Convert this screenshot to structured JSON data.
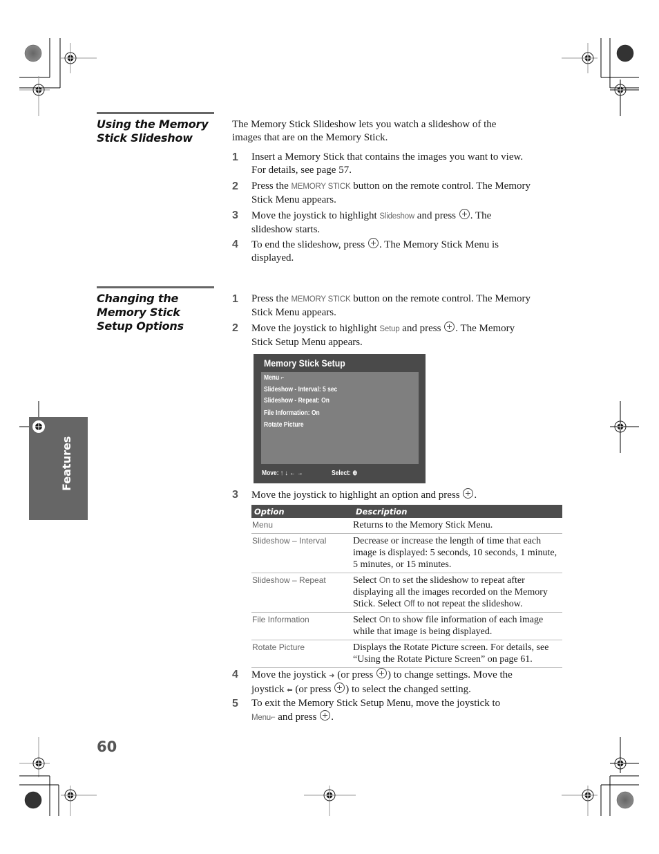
{
  "section1": {
    "title_line1": "Using the Memory",
    "title_line2": "Stick Slideshow",
    "intro_line1": "The Memory Stick Slideshow lets you watch a slideshow of the",
    "intro_line2": "images that are on the Memory Stick.",
    "steps": [
      {
        "num": "1",
        "line1": "Insert a Memory Stick that contains the images you want to view.",
        "line2": "For details, see page 57."
      },
      {
        "num": "2",
        "pre": "Press the ",
        "ui": "MEMORY STICK",
        "post": " button on the remote control. The Memory",
        "line2": "Stick Menu appears."
      },
      {
        "num": "3",
        "pre": "Move the joystick to highlight ",
        "ui": "Slideshow",
        "post": " and press ",
        "post2": ". The",
        "line2": "slideshow starts."
      },
      {
        "num": "4",
        "pre": "To end the slideshow, press ",
        "post": ". The Memory Stick Menu is",
        "line2": "displayed."
      }
    ]
  },
  "section2": {
    "title_line1": "Changing the",
    "title_line2": "Memory Stick",
    "title_line3": "Setup Options",
    "steps": [
      {
        "num": "1",
        "pre": "Press the ",
        "ui": "MEMORY STICK",
        "post": " button on the remote control. The Memory",
        "line2": "Stick Menu appears."
      },
      {
        "num": "2",
        "pre": "Move the joystick to highlight ",
        "ui": "Setup",
        "post": " and press ",
        "post2": ". The Memory",
        "line2": "Stick Setup Menu appears."
      },
      {
        "num": "3",
        "pre": "Move the joystick to highlight an option and press ",
        "post": "."
      },
      {
        "num": "4",
        "pre": "Move the joystick ",
        "a": " (or press ",
        "b": ") to change settings. Move the",
        "line2a": "joystick ",
        "line2b": " (or press ",
        "line2c": ") to select the changed setting."
      },
      {
        "num": "5",
        "line1": "To exit the Memory Stick Setup Menu, move the joystick to",
        "ui": "Menu",
        "post": " and press ",
        "post2": "."
      }
    ]
  },
  "osd": {
    "title": "Memory Stick Setup",
    "items": [
      "Menu ⌐",
      "Slideshow - Interval: 5 sec",
      "Slideshow - Repeat: On",
      "File Information: On",
      "Rotate Picture"
    ],
    "move_label": "Move: ↑ ↓ ← →",
    "select_label": "Select: ⊕"
  },
  "table": {
    "headers": [
      "Option",
      "Description"
    ],
    "rows": [
      {
        "option": "Menu",
        "desc": "Returns to the Memory Stick Menu."
      },
      {
        "option": "Slideshow – Interval",
        "desc": "Decrease or increase the length of time that each image is displayed: 5 seconds, 10 seconds, 1 minute, 5 minutes, or 15 minutes."
      },
      {
        "option": "Slideshow – Repeat",
        "desc_pre": "Select ",
        "on": "On",
        "desc_mid": " to set the slideshow to repeat after displaying all the images recorded on the Memory Stick. Select ",
        "off": "Off",
        "desc_post": " to not repeat the slideshow."
      },
      {
        "option": "File Information",
        "desc_pre": "Select ",
        "on": "On",
        "desc_post": " to show file information of each image while that image is being displayed."
      },
      {
        "option": "Rotate Picture",
        "desc": "Displays the Rotate Picture screen. For details, see “Using the Rotate Picture Screen” on page 61."
      }
    ]
  },
  "side_tab": {
    "label": "Features"
  },
  "page_number": "60",
  "icons": {
    "right_arrow": "➜",
    "left_arrow": "⬅",
    "menu_return": "⌐"
  }
}
